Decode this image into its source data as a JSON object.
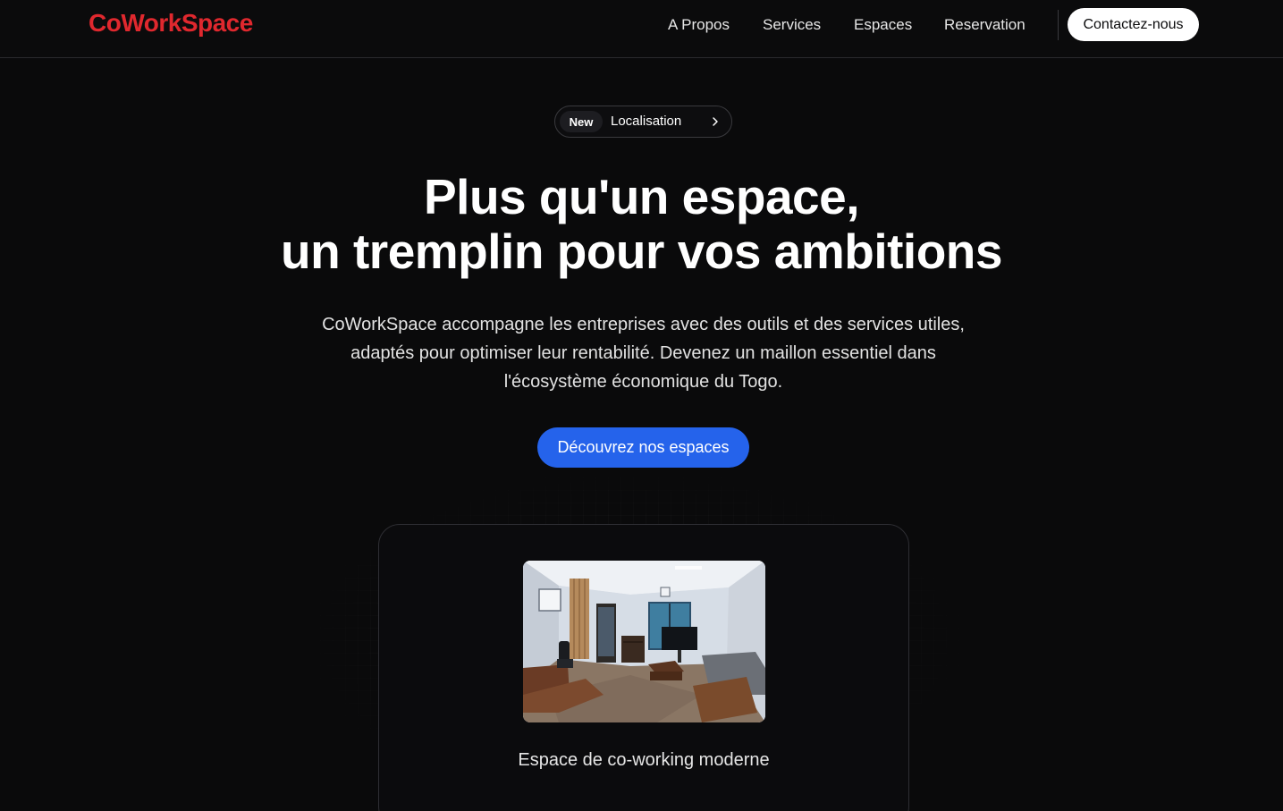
{
  "header": {
    "logo": "CoWorkSpace",
    "nav": [
      "A Propos",
      "Services",
      "Espaces",
      "Reservation"
    ],
    "contact_label": "Contactez-nous"
  },
  "badge": {
    "tag": "New",
    "label": "Localisation"
  },
  "hero": {
    "title_line1": "Plus qu'un espace,",
    "title_line2": "un tremplin pour vos ambitions",
    "description": "CoWorkSpace accompagne les entreprises avec des outils et des services utiles, adaptés pour optimiser leur rentabilité. Devenez un maillon essentiel dans l'écosystème économique du Togo.",
    "cta_label": "Découvrez nos espaces"
  },
  "card": {
    "caption": "Espace de co-working moderne"
  },
  "colors": {
    "brand": "#e0282e",
    "cta": "#2563eb",
    "background": "#0a0a0b"
  }
}
